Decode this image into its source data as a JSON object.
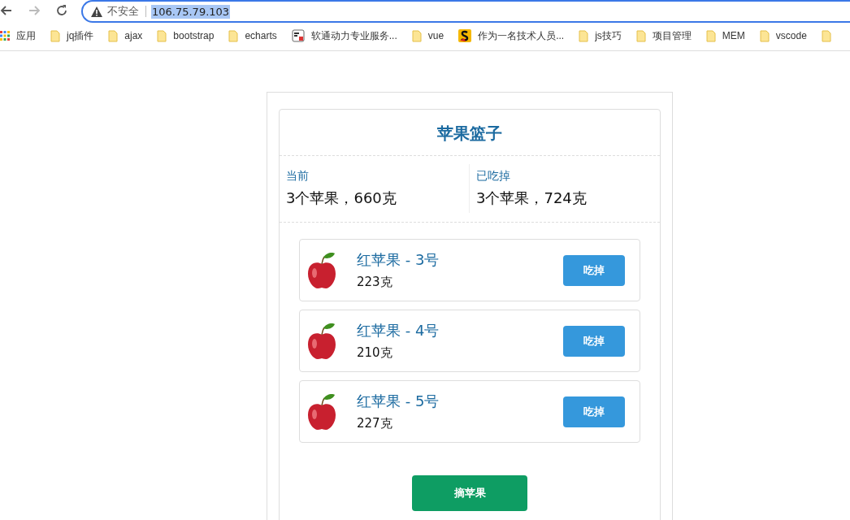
{
  "browser": {
    "security_label": "不安全",
    "url": "106.75.79.103",
    "url_selected": true,
    "bookmarks": [
      {
        "kind": "apps",
        "label": "应用"
      },
      {
        "kind": "folder",
        "label": "jq插件"
      },
      {
        "kind": "folder",
        "label": "ajax"
      },
      {
        "kind": "folder",
        "label": "bootstrap"
      },
      {
        "kind": "folder",
        "label": "echarts"
      },
      {
        "kind": "psa",
        "label": "软通动力专业服务..."
      },
      {
        "kind": "folder",
        "label": "vue"
      },
      {
        "kind": "slogo",
        "label": "作为一名技术人员..."
      },
      {
        "kind": "folder",
        "label": "js技巧"
      },
      {
        "kind": "folder",
        "label": "项目管理"
      },
      {
        "kind": "folder",
        "label": "MEM"
      },
      {
        "kind": "folder",
        "label": "vscode"
      },
      {
        "kind": "folder"
      }
    ]
  },
  "basket": {
    "title": "苹果篮子",
    "stats": [
      {
        "label": "当前",
        "value": "3个苹果，660克"
      },
      {
        "label": "已吃掉",
        "value": "3个苹果，724克"
      }
    ],
    "apples": [
      {
        "name": "红苹果 - 3号",
        "weight": "223克",
        "action": "吃掉"
      },
      {
        "name": "红苹果 - 4号",
        "weight": "210克",
        "action": "吃掉"
      },
      {
        "name": "红苹果 - 5号",
        "weight": "227克",
        "action": "吃掉"
      }
    ],
    "pick_button": "摘苹果"
  }
}
